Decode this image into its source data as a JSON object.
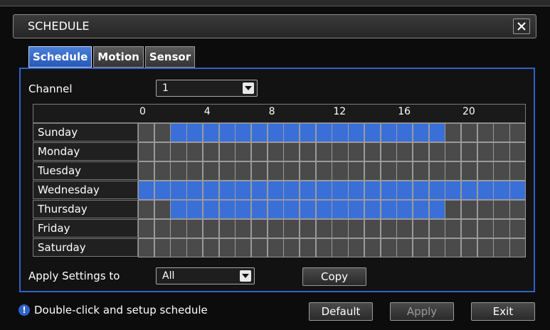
{
  "window": {
    "title": "SCHEDULE",
    "close_icon": "close-icon"
  },
  "tabs": [
    {
      "label": "Schedule",
      "active": true
    },
    {
      "label": "Motion",
      "active": false
    },
    {
      "label": "Sensor",
      "active": false
    }
  ],
  "channel": {
    "label": "Channel",
    "value": "1"
  },
  "grid": {
    "hour_ticks": [
      "0",
      "4",
      "8",
      "12",
      "16",
      "20"
    ],
    "days": [
      {
        "name": "Sunday",
        "on": [
          0,
          0,
          1,
          1,
          1,
          1,
          1,
          1,
          1,
          1,
          1,
          1,
          1,
          1,
          1,
          1,
          1,
          1,
          1,
          0,
          0,
          0,
          0,
          0
        ]
      },
      {
        "name": "Monday",
        "on": [
          0,
          0,
          0,
          0,
          0,
          0,
          0,
          0,
          0,
          0,
          0,
          0,
          0,
          0,
          0,
          0,
          0,
          0,
          0,
          0,
          0,
          0,
          0,
          0
        ]
      },
      {
        "name": "Tuesday",
        "on": [
          0,
          0,
          0,
          0,
          0,
          0,
          0,
          0,
          0,
          0,
          0,
          0,
          0,
          0,
          0,
          0,
          0,
          0,
          0,
          0,
          0,
          0,
          0,
          0
        ]
      },
      {
        "name": "Wednesday",
        "on": [
          1,
          1,
          1,
          1,
          1,
          1,
          1,
          1,
          1,
          1,
          1,
          1,
          1,
          1,
          1,
          1,
          1,
          1,
          1,
          1,
          1,
          1,
          1,
          1
        ]
      },
      {
        "name": "Thursday",
        "on": [
          0,
          0,
          1,
          1,
          1,
          1,
          1,
          1,
          1,
          1,
          1,
          1,
          1,
          1,
          1,
          1,
          1,
          1,
          1,
          0,
          0,
          0,
          0,
          0
        ]
      },
      {
        "name": "Friday",
        "on": [
          0,
          0,
          0,
          0,
          0,
          0,
          0,
          0,
          0,
          0,
          0,
          0,
          0,
          0,
          0,
          0,
          0,
          0,
          0,
          0,
          0,
          0,
          0,
          0
        ]
      },
      {
        "name": "Saturday",
        "on": [
          0,
          0,
          0,
          0,
          0,
          0,
          0,
          0,
          0,
          0,
          0,
          0,
          0,
          0,
          0,
          0,
          0,
          0,
          0,
          0,
          0,
          0,
          0,
          0
        ]
      }
    ],
    "colors": {
      "on": "#3a6fd8",
      "off": "#4a4a4a",
      "line": "#9a9a9a"
    }
  },
  "apply_settings": {
    "label": "Apply Settings to",
    "value": "All"
  },
  "buttons": {
    "copy": "Copy",
    "default": "Default",
    "apply": "Apply",
    "exit": "Exit"
  },
  "footer": {
    "note": "Double-click and setup schedule"
  },
  "colors": {
    "accent": "#2f62c8"
  }
}
